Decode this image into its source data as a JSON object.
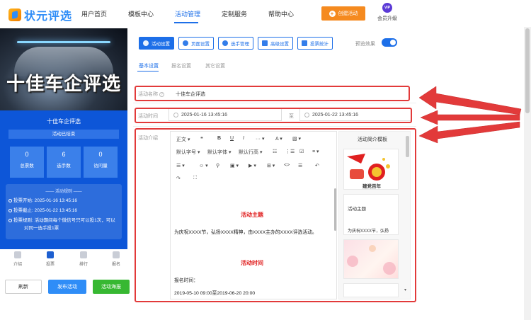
{
  "brand": {
    "name": "状元评选"
  },
  "nav": {
    "items": [
      "用户首页",
      "模板中心",
      "活动管理",
      "定制服务",
      "帮助中心"
    ],
    "active": "活动管理",
    "create_label": "创建活动",
    "vip_badge": "VIP",
    "vip_label": "会员升级"
  },
  "preview": {
    "banner_title": "十佳车企评选",
    "panel_title": "十佳车企评选",
    "status": "活动已结束",
    "stats": [
      {
        "value": "0",
        "label": "总票数"
      },
      {
        "value": "6",
        "label": "选手数"
      },
      {
        "value": "0",
        "label": "访问量"
      }
    ],
    "rules_header": "—— 活动规则 ——",
    "rules": [
      "投票开始: 2025-01-16 13:45:16",
      "投票截止: 2025-01-22 13:45:16",
      "投票规则: 活动期间每个微信号只可以投1次，可以",
      "对同一选手投1票"
    ],
    "bottom_tabs": [
      "介绍",
      "投票",
      "排行",
      "报名"
    ],
    "buttons": {
      "refresh": "刷新",
      "publish": "发布活动",
      "poster": "活动海报"
    }
  },
  "toolbar": {
    "buttons": [
      "活动设置",
      "页面设置",
      "选手管理",
      "高级设置",
      "投票统计"
    ],
    "active": "活动设置",
    "preview_label": "预览效果",
    "preview_enabled": true
  },
  "subtabs": {
    "items": [
      "基本设置",
      "报名设置",
      "其它设置"
    ],
    "active": "基本设置"
  },
  "form": {
    "name_label": "活动名称",
    "name_value": "十佳车企评选",
    "time_label": "活动时间",
    "start_time": "2025-01-16 13:45:16",
    "to_label": "至",
    "end_time": "2025-01-22 13:45:16",
    "intro_label": "活动介绍"
  },
  "editor": {
    "toolbar_row1": [
      "正文 ▾",
      "❝",
      "B",
      "U",
      "I",
      "··· ▾",
      "A ▾",
      "▧ ▾"
    ],
    "toolbar_row2": [
      "默认字号 ▾",
      "默认字体 ▾",
      "默认行高 ▾",
      "☷",
      "⋮☰",
      "☑",
      "≡ ▾"
    ],
    "toolbar_row3": [
      "☰ ▾",
      "☺ ▾",
      "⚲",
      "▣ ▾",
      "▶ ▾",
      "⊞ ▾",
      "<>",
      "☰",
      "↶"
    ],
    "toolbar_row4": [
      "↷",
      "⛶"
    ],
    "heading1": "活动主题",
    "paragraph1": "为庆祝XXXX节，弘扬XXXX精神，由XXXX主办的XXXX评选活动。",
    "heading2": "活动时间",
    "paragraph2": "报名时间：",
    "paragraph3": "2019-05-10 09:00至2019-06-20 20:00"
  },
  "templates": {
    "title": "活动简介模板",
    "card1_caption": "建党百年",
    "card2_title": "活动主题",
    "card2_text": "为庆祝XXXX节，弘扬"
  },
  "colors": {
    "accent": "#1d6fe8",
    "highlight": "#e23a3a",
    "orange": "#f58a1f",
    "green": "#37b832"
  }
}
